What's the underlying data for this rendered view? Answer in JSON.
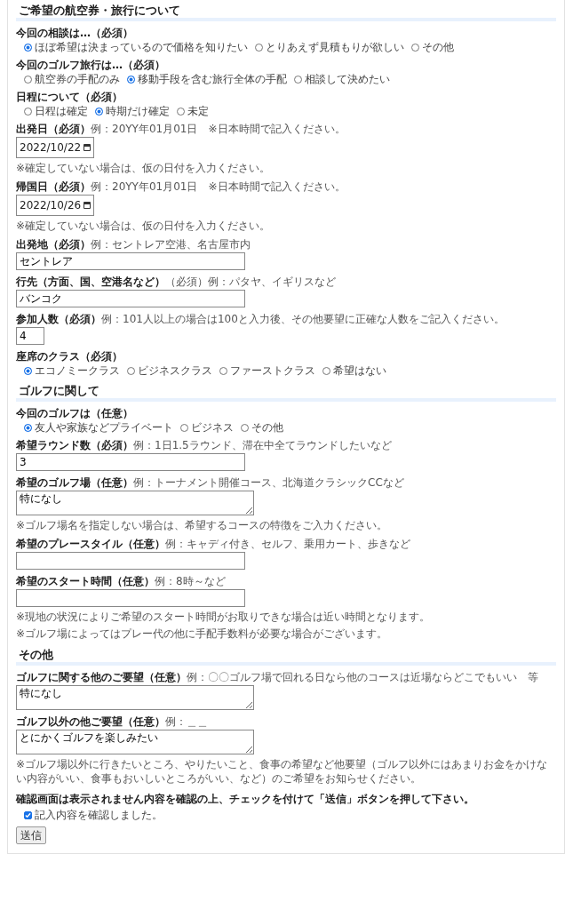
{
  "sections": [
    {
      "title": "ご希望の航空券・旅行について",
      "items": [
        {
          "kind": "radio",
          "label": "今回の相談は…（必須）",
          "options": [
            {
              "label": "ほぼ希望は決まっているので価格を知りたい",
              "selected": true
            },
            {
              "label": "とりあえず見積もりが欲しい",
              "selected": false
            },
            {
              "label": "その他",
              "selected": false
            }
          ]
        },
        {
          "kind": "radio",
          "label": "今回のゴルフ旅行は…（必須）",
          "options": [
            {
              "label": "航空券の手配のみ",
              "selected": false
            },
            {
              "label": "移動手段を含む旅行全体の手配",
              "selected": true
            },
            {
              "label": "相談して決めたい",
              "selected": false
            }
          ]
        },
        {
          "kind": "radio",
          "label": "日程について（必須）",
          "options": [
            {
              "label": "日程は確定",
              "selected": false
            },
            {
              "label": "時期だけ確定",
              "selected": true
            },
            {
              "label": "未定",
              "selected": false
            }
          ]
        },
        {
          "kind": "date",
          "label": "出発日（必須）",
          "hint": "例：20YY年01月01日　※日本時間で記入ください。",
          "value": "2022/10/22"
        },
        {
          "kind": "note",
          "lines": [
            "※確定していない場合は、仮の日付を入力ください。"
          ]
        },
        {
          "kind": "date",
          "label": "帰国日（必須）",
          "hint": "例：20YY年01月01日　※日本時間で記入ください。",
          "value": "2022/10/26"
        },
        {
          "kind": "note",
          "lines": [
            "※確定していない場合は、仮の日付を入力ください。"
          ]
        },
        {
          "kind": "text",
          "label": "出発地（必須）",
          "hint": "例：セントレア空港、名古屋市内",
          "value": "セントレア"
        },
        {
          "kind": "text",
          "label": "行先（方面、国、空港名など）",
          "hint": "（必須）例：パタヤ、イギリスなど",
          "value": "バンコク"
        },
        {
          "kind": "number",
          "label": "参加人数（必須）",
          "hint": "例：101人以上の場合は100と入力後、その他要望に正確な人数をご記入ください。",
          "value": "4"
        },
        {
          "kind": "radio",
          "label": "座席のクラス（必須）",
          "options": [
            {
              "label": "エコノミークラス",
              "selected": true
            },
            {
              "label": "ビジネスクラス",
              "selected": false
            },
            {
              "label": "ファーストクラス",
              "selected": false
            },
            {
              "label": "希望はない",
              "selected": false
            }
          ]
        }
      ]
    },
    {
      "title": "ゴルフに関して",
      "items": [
        {
          "kind": "radio",
          "label": "今回のゴルフは（任意）",
          "options": [
            {
              "label": "友人や家族などプライベート",
              "selected": true
            },
            {
              "label": "ビジネス",
              "selected": false
            },
            {
              "label": "その他",
              "selected": false
            }
          ]
        },
        {
          "kind": "text",
          "label": "希望ラウンド数（必須）",
          "hint": "例：1日1.5ラウンド、滞在中全てラウンドしたいなど",
          "value": "3"
        },
        {
          "kind": "textarea",
          "label": "希望のゴルフ場（任意）",
          "hint": "例：トーナメント開催コース、北海道クラシックCCなど",
          "value": "特になし"
        },
        {
          "kind": "note",
          "lines": [
            "※ゴルフ場名を指定しない場合は、希望するコースの特徴をご入力ください。"
          ]
        },
        {
          "kind": "text",
          "label": "希望のプレースタイル（任意）",
          "hint": "例：キャディ付き、セルフ、乗用カート、歩きなど",
          "value": ""
        },
        {
          "kind": "text",
          "label": "希望のスタート時間（任意）",
          "hint": "例：8時～など",
          "value": ""
        },
        {
          "kind": "note",
          "lines": [
            "※現地の状況によりご希望のスタート時間がお取りできな場合は近い時間となります。",
            "※ゴルフ場によってはプレー代の他に手配手数料が必要な場合がございます。"
          ]
        }
      ]
    },
    {
      "title": "その他",
      "items": [
        {
          "kind": "textarea",
          "label": "ゴルフに関する他のご要望（任意）",
          "hint": "例：〇〇ゴルフ場で回れる日なら他のコースは近場ならどこでもいい　等",
          "value": "特になし"
        },
        {
          "kind": "textarea",
          "label": "ゴルフ以外の他ご要望（任意）",
          "hint": "例：＿＿",
          "value": "とにかくゴルフを楽しみたい"
        },
        {
          "kind": "note",
          "lines": [
            "※ゴルフ場以外に行きたいところ、やりたいこと、食事の希望など他要望（ゴルフ以外にはあまりお金をかけない内容がいい、食事もおいしいところがいい、など）のご希望をお知らせください。"
          ]
        }
      ]
    }
  ],
  "confirm": {
    "instruction": "確認画面は表示されません内容を確認の上、チェックを付けて「送信」ボタンを押して下さい。",
    "checkbox_label": "記入内容を確認しました。",
    "checked": true
  },
  "submit": "送信"
}
